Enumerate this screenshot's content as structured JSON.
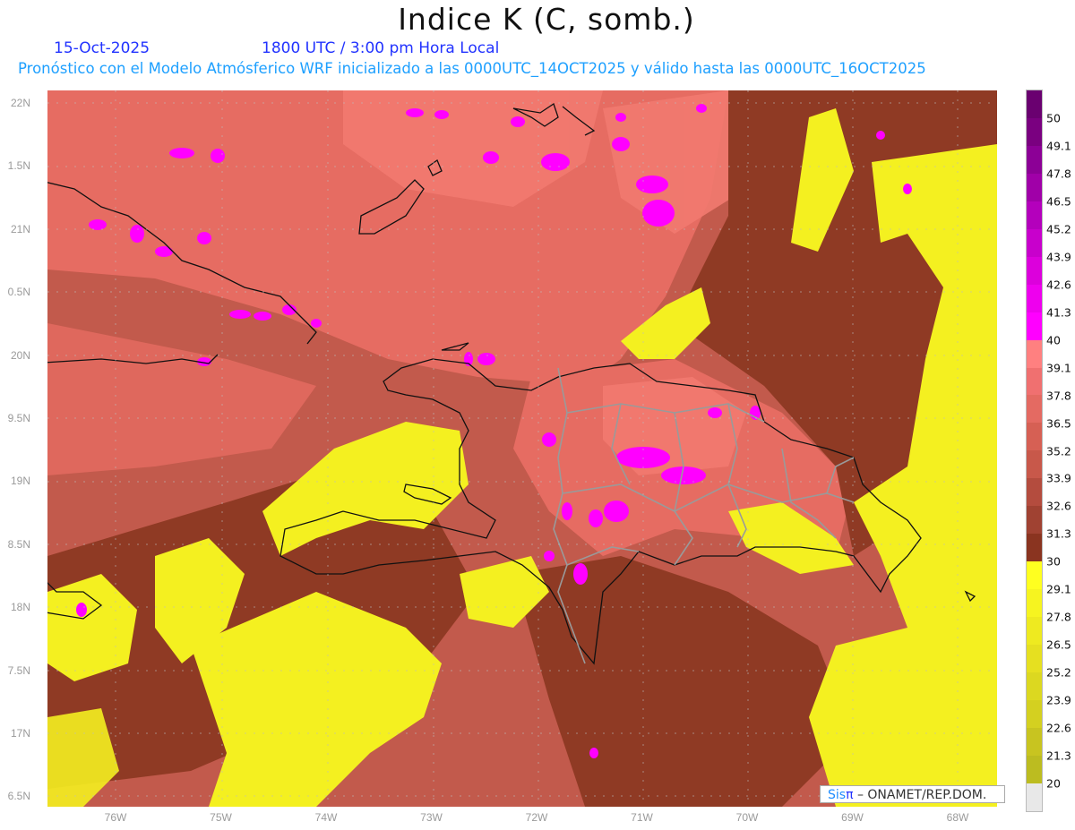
{
  "header": {
    "title": "Indice K (C, somb.)",
    "date": "15-Oct-2025",
    "time": "1800 UTC / 3:00 pm Hora Local",
    "description": "Pronóstico con el Modelo Atmósferico WRF inicializado a las 0000UTC_14OCT2025 y válido hasta las  0000UTC_16OCT2025"
  },
  "axes": {
    "lat_labels": [
      "22N",
      "1.5N",
      "21N",
      "0.5N",
      "20N",
      "9.5N",
      "19N",
      "8.5N",
      "18N",
      "7.5N",
      "17N",
      "6.5N"
    ],
    "lon_labels": [
      "76W",
      "75W",
      "74W",
      "73W",
      "72W",
      "71W",
      "70W",
      "69W",
      "68W"
    ]
  },
  "colorbar": {
    "labels": [
      "50",
      "49.1",
      "47.8",
      "46.5",
      "45.2",
      "43.9",
      "42.6",
      "41.3",
      "40",
      "39.1",
      "37.8",
      "36.5",
      "35.2",
      "33.9",
      "32.6",
      "31.3",
      "30",
      "29.1",
      "27.8",
      "26.5",
      "25.2",
      "23.9",
      "22.6",
      "21.3",
      "20"
    ],
    "colors": [
      "#6a0070",
      "#7a0080",
      "#8c0096",
      "#a000a8",
      "#b400bc",
      "#c800cc",
      "#dc00dc",
      "#ee00ee",
      "#ff00ff",
      "#ff8080",
      "#f07070",
      "#e46a62",
      "#d66054",
      "#c8584a",
      "#b44c3e",
      "#a04232",
      "#8a3420",
      "#ffff20",
      "#f6f420",
      "#eeea20",
      "#e6e020",
      "#dcd820",
      "#d4d020",
      "#c8c420",
      "#bcbc20",
      "#e8e8e8"
    ]
  },
  "credit": {
    "brand_sis": "Sis",
    "brand_pi": "π",
    "text": " –  ONAMET/REP.DOM."
  },
  "colors": {
    "base": "#c25a4c",
    "pink": "#ea7066",
    "dark": "#8f3a24",
    "yellow": "#f4f020",
    "magenta": "#ff00ff"
  }
}
